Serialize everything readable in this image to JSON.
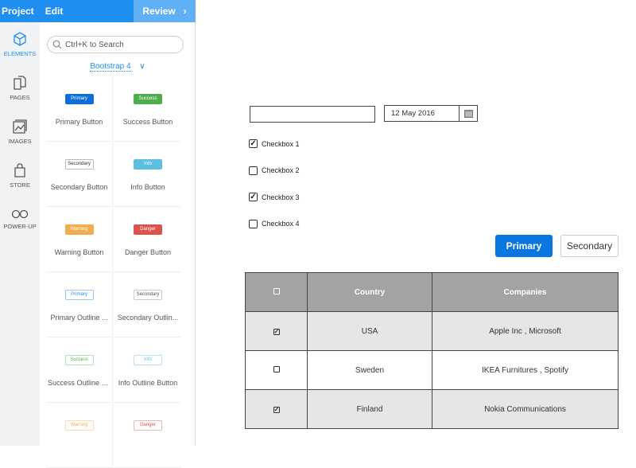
{
  "topbar": {
    "project": "Project",
    "edit": "Edit",
    "review": "Review",
    "review_icon": "chevron-right-icon"
  },
  "rail": [
    {
      "label": "ELEMENTS",
      "icon": "cube-icon"
    },
    {
      "label": "PAGES",
      "icon": "pages-icon"
    },
    {
      "label": "IMAGES",
      "icon": "image-icon"
    },
    {
      "label": "STORE",
      "icon": "bag-icon"
    },
    {
      "label": "POWER-UP",
      "icon": "infinity-icon"
    }
  ],
  "panel": {
    "search_placeholder": "Ctrl+K to Search",
    "library": "Bootstrap 4",
    "tiles": [
      {
        "mini": "Primary",
        "label": "Primary Button"
      },
      {
        "mini": "Success",
        "label": "Success Button"
      },
      {
        "mini": "Secondary",
        "label": "Secondary Button"
      },
      {
        "mini": "Info",
        "label": "Info Button"
      },
      {
        "mini": "Warning",
        "label": "Warning Button"
      },
      {
        "mini": "Danger",
        "label": "Danger Button"
      },
      {
        "mini": "Primary",
        "label": "Primary Outline ..."
      },
      {
        "mini": "Secondary",
        "label": "Secondary Outlin..."
      },
      {
        "mini": "Success",
        "label": "Success Outline B..."
      },
      {
        "mini": "Info",
        "label": "Info Outline Button"
      },
      {
        "mini": "Warning",
        "label": ""
      },
      {
        "mini": "Danger",
        "label": ""
      }
    ]
  },
  "canvas": {
    "text_input": "",
    "date": "12 May 2016",
    "checkboxes": [
      {
        "label": "Checkbox 1",
        "checked": true
      },
      {
        "label": "Checkbox 2",
        "checked": false
      },
      {
        "label": "Checkbox 3",
        "checked": true
      },
      {
        "label": "Checkbox 4",
        "checked": false
      }
    ],
    "primary_button": "Primary",
    "secondary_button": "Secondary",
    "table": {
      "headers": [
        "",
        "Country",
        "Companies"
      ],
      "rows": [
        {
          "checked": true,
          "country": "USA",
          "companies": "Apple Inc , Microsoft"
        },
        {
          "checked": false,
          "country": "Sweden",
          "companies": "IKEA Furnitures , Spotify"
        },
        {
          "checked": true,
          "country": "Finland",
          "companies": "Nokia Communications"
        }
      ]
    }
  },
  "colors": {
    "accent": "#1e8ff0",
    "success": "#4cae4c",
    "info": "#5bc0de",
    "warning": "#f0ad4e",
    "danger": "#d9534f"
  }
}
